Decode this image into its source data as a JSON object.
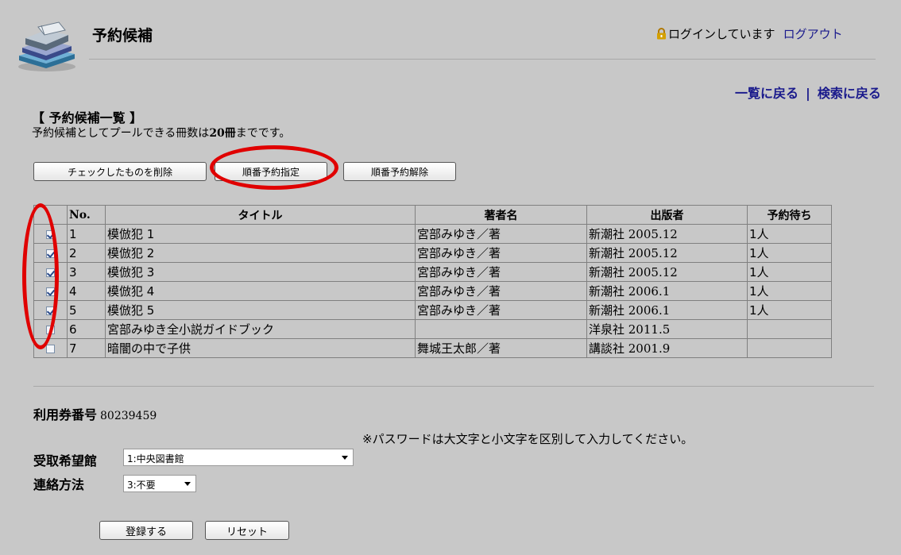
{
  "header": {
    "title": "予約候補",
    "login_status": "ログインしています",
    "logout_label": "ログアウト"
  },
  "nav": {
    "back_to_list": "一覧に戻る",
    "separator": "|",
    "back_to_search": "検索に戻る"
  },
  "section": {
    "heading": "【 予約候補一覧 】",
    "note_prefix": "予約候補としてプールできる冊数は",
    "note_count": "20冊",
    "note_suffix": "までです。"
  },
  "buttons": {
    "delete_checked": "チェックしたものを削除",
    "set_sequence": "順番予約指定",
    "clear_sequence": "順番予約解除"
  },
  "table": {
    "headers": [
      "",
      "No.",
      "タイトル",
      "著者名",
      "出版者",
      "予約待ち"
    ],
    "rows": [
      {
        "checked": true,
        "no": "1",
        "title": "模倣犯 1",
        "author": "宮部みゆき／著",
        "publisher": "新潮社 2005.12",
        "waiting": "1人"
      },
      {
        "checked": true,
        "no": "2",
        "title": "模倣犯 2",
        "author": "宮部みゆき／著",
        "publisher": "新潮社 2005.12",
        "waiting": "1人"
      },
      {
        "checked": true,
        "no": "3",
        "title": "模倣犯 3",
        "author": "宮部みゆき／著",
        "publisher": "新潮社 2005.12",
        "waiting": "1人"
      },
      {
        "checked": true,
        "no": "4",
        "title": "模倣犯 4",
        "author": "宮部みゆき／著",
        "publisher": "新潮社 2006.1",
        "waiting": "1人"
      },
      {
        "checked": true,
        "no": "5",
        "title": "模倣犯 5",
        "author": "宮部みゆき／著",
        "publisher": "新潮社 2006.1",
        "waiting": "1人"
      },
      {
        "checked": false,
        "no": "6",
        "title": "宮部みゆき全小説ガイドブック",
        "author": "",
        "publisher": "洋泉社 2011.5",
        "waiting": ""
      },
      {
        "checked": false,
        "no": "7",
        "title": "暗闇の中で子供",
        "author": "舞城王太郎／著",
        "publisher": "講談社 2001.9",
        "waiting": ""
      }
    ]
  },
  "form": {
    "card_label": "利用券番号",
    "card_number": "80239459",
    "password_note": "※パスワードは大文字と小文字を区別して入力してください。",
    "pickup_label": "受取希望館",
    "pickup_value": "1:中央図書館",
    "contact_label": "連絡方法",
    "contact_value": "3:不要",
    "submit_label": "登録する",
    "reset_label": "リセット"
  },
  "colors": {
    "background": "#c8c8c8",
    "link": "#1a1a8c",
    "highlight_ring": "#e00000",
    "lock_icon": "#d4a000"
  },
  "icons": {
    "logo": "books-stack-icon",
    "lock": "lock-icon",
    "checkbox": "checkbox-icon",
    "dropdown": "chevron-down-icon"
  }
}
